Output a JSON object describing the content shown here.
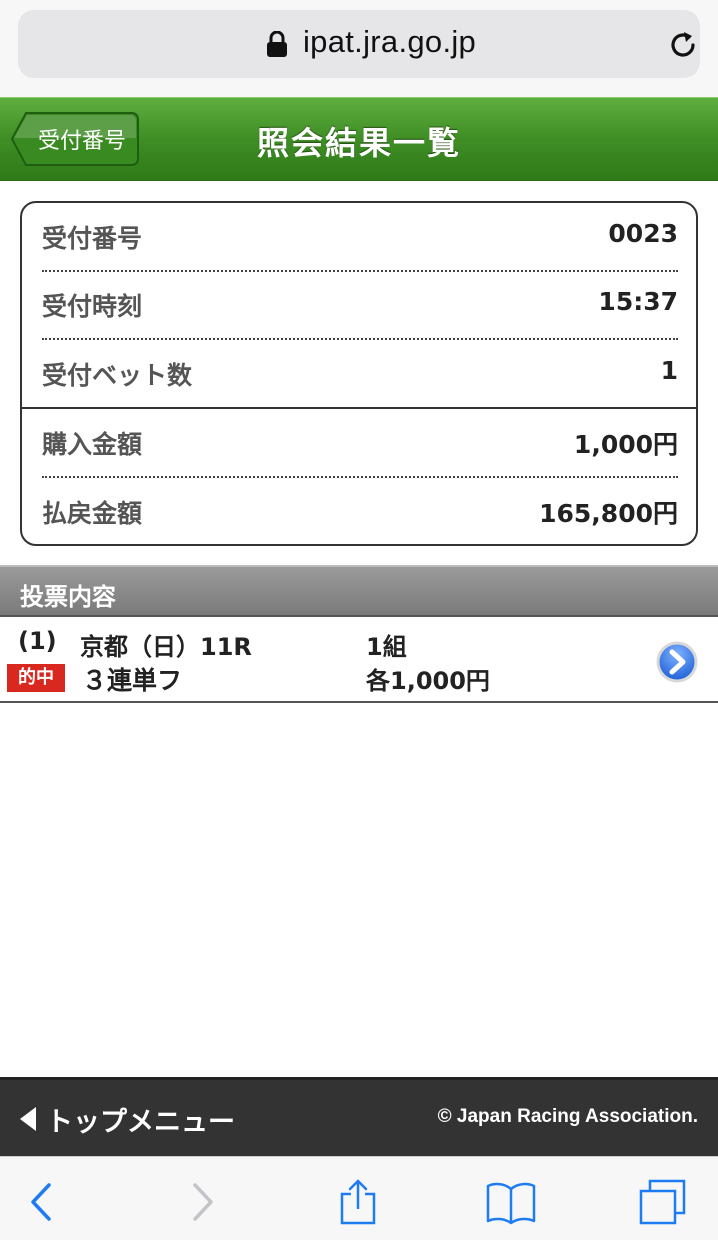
{
  "browser": {
    "url": "ipat.jra.go.jp",
    "lock_icon": "lock-icon",
    "reload_icon": "reload-icon",
    "toolbar": {
      "back_icon": "chevron-left-icon",
      "forward_icon": "chevron-right-icon",
      "share_icon": "share-icon",
      "bookmarks_icon": "book-icon",
      "tabs_icon": "tabs-icon",
      "active_color": "#1e7cf2",
      "disabled_color": "#c4c4c8"
    }
  },
  "header": {
    "back_label": "受付番号",
    "title": "照会結果一覧",
    "color": "#3f8e25"
  },
  "summary": {
    "rows": [
      {
        "label": "受付番号",
        "value": "0023"
      },
      {
        "label": "受付時刻",
        "value": "15:37"
      },
      {
        "label": "受付ベット数",
        "value": "1"
      },
      {
        "label": "購入金額",
        "value": "1,000円"
      },
      {
        "label": "払戻金額",
        "value": "165,800円"
      }
    ]
  },
  "section": {
    "title": "投票内容"
  },
  "bets": [
    {
      "number": "(1)",
      "race": "京都（日）11R",
      "combos": "1組",
      "badge": "的中",
      "badge_color": "#d9281f",
      "type": "３連単フ",
      "amount": "各1,000円",
      "arrow_icon": "chevron-right-circle-icon"
    }
  ],
  "footer": {
    "top_menu": "トップメニュー",
    "copyright": "© Japan Racing Association."
  }
}
